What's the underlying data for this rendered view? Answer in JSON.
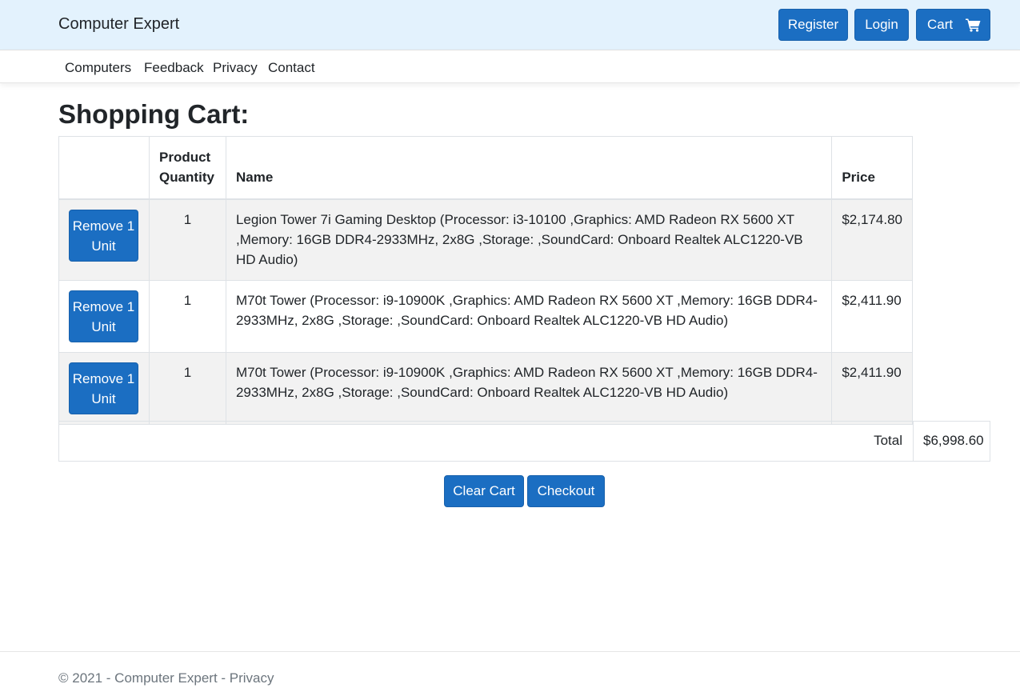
{
  "header": {
    "brand": "Computer Expert",
    "register_label": "Register",
    "login_label": "Login",
    "cart_label": "Cart",
    "cart_icon": "shopping-cart-icon"
  },
  "nav": {
    "items": [
      "Computers",
      "Feedback",
      "Privacy",
      "Contact"
    ]
  },
  "main": {
    "title": "Shopping Cart:",
    "table": {
      "headers": [
        "",
        "Product Quantity",
        "Name",
        "Price"
      ],
      "rows": [
        {
          "button": "Remove 1 Unit",
          "quantity": "1",
          "name": "Legion Tower 7i Gaming Desktop (Processor: i3-10100 ,Graphics: AMD Radeon RX 5600 XT ,Memory: 16GB DDR4-2933MHz, 2x8G ,Storage: ,SoundCard: Onboard Realtek ALC1220-VB HD Audio)",
          "price": "$2,174.80"
        },
        {
          "button": "Remove 1 Unit",
          "quantity": "1",
          "name": "M70t Tower (Processor: i9-10900K ,Graphics: AMD Radeon RX 5600 XT ,Memory: 16GB DDR4-2933MHz, 2x8G ,Storage: ,SoundCard: Onboard Realtek ALC1220-VB HD Audio)",
          "price": "$2,411.90"
        },
        {
          "button": "Remove 1 Unit",
          "quantity": "1",
          "name": "M70t Tower (Processor: i9-10900K ,Graphics: AMD Radeon RX 5600 XT ,Memory: 16GB DDR4-2933MHz, 2x8G ,Storage: ,SoundCard: Onboard Realtek ALC1220-VB HD Audio)",
          "price": "$2,411.90"
        }
      ],
      "total_label": "Total",
      "total_value": "$6,998.60"
    },
    "clear_label": "Clear Cart",
    "checkout_label": "Checkout"
  },
  "footer": {
    "text": "© 2021 - Computer Expert - Privacy"
  },
  "colors": {
    "topbar": "#e3f2fd",
    "button": "#1b6ec2",
    "row_stripe": "#f2f2f2"
  }
}
